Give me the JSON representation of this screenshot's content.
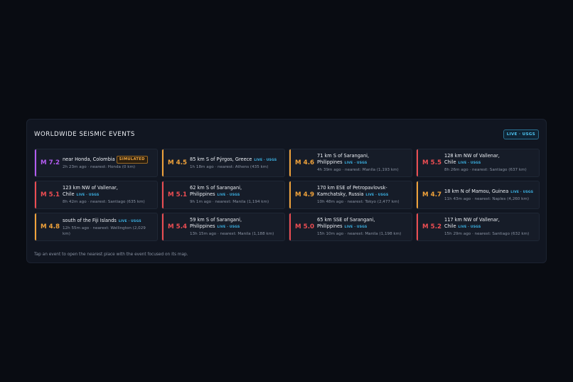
{
  "panel": {
    "title": "WORLDWIDE SEISMIC EVENTS",
    "badge": "LIVE · USGS",
    "footer": "Tap an event to open the nearest place with the event focused on its map."
  },
  "colors": {
    "purple": "#b25cf0",
    "orange": "#f0a23a",
    "red": "#ec4d52"
  },
  "events": [
    {
      "mag": "M 7.2",
      "color": "#b25cf0",
      "place": "near Honda, Colombia",
      "source": "",
      "badge": "SIMULATED",
      "meta": "2h 23m ago · nearest: Honda (0 km)"
    },
    {
      "mag": "M 4.5",
      "color": "#f0a23a",
      "place": "85 km S of Pýrgos, Greece",
      "source": "LIVE · USGS",
      "badge": "",
      "meta": "1h 18m ago · nearest: Athens (435 km)"
    },
    {
      "mag": "M 4.6",
      "color": "#f0a23a",
      "place": "71 km S of Sarangani, Philippines",
      "source": "LIVE · USGS",
      "badge": "",
      "meta": "4h 39m ago · nearest: Manila (1,193 km)"
    },
    {
      "mag": "M 5.5",
      "color": "#ec4d52",
      "place": "128 km NW of Vallenar, Chile",
      "source": "LIVE · USGS",
      "badge": "",
      "meta": "8h 26m ago · nearest: Santiago (637 km)"
    },
    {
      "mag": "M 5.1",
      "color": "#ec4d52",
      "place": "123 km NW of Vallenar, Chile",
      "source": "LIVE · USGS",
      "badge": "",
      "meta": "8h 42m ago · nearest: Santiago (635 km)"
    },
    {
      "mag": "M 5.1",
      "color": "#ec4d52",
      "place": "62 km S of Sarangani, Philippines",
      "source": "LIVE · USGS",
      "badge": "",
      "meta": "9h 1m ago · nearest: Manila (1,194 km)"
    },
    {
      "mag": "M 4.9",
      "color": "#f0a23a",
      "place": "170 km ESE of Petropavlovsk-Kamchatsky, Russia",
      "source": "LIVE · USGS",
      "badge": "",
      "meta": "10h 48m ago · nearest: Tokyo (2,477 km)"
    },
    {
      "mag": "M 4.7",
      "color": "#f0a23a",
      "place": "18 km N of Mamou, Guinea",
      "source": "LIVE · USGS",
      "badge": "",
      "meta": "11h 43m ago · nearest: Naples (4,260 km)"
    },
    {
      "mag": "M 4.8",
      "color": "#f0a23a",
      "place": "south of the Fiji Islands",
      "source": "LIVE · USGS",
      "badge": "",
      "meta": "12h 55m ago · nearest: Wellington (2,029 km)"
    },
    {
      "mag": "M 5.4",
      "color": "#ec4d52",
      "place": "59 km S of Sarangani, Philippines",
      "source": "LIVE · USGS",
      "badge": "",
      "meta": "13h 15m ago · nearest: Manila (1,188 km)"
    },
    {
      "mag": "M 5.0",
      "color": "#ec4d52",
      "place": "65 km SSE of Sarangani, Philippines",
      "source": "LIVE · USGS",
      "badge": "",
      "meta": "15h 10m ago · nearest: Manila (1,198 km)"
    },
    {
      "mag": "M 5.2",
      "color": "#ec4d52",
      "place": "117 km NW of Vallenar, Chile",
      "source": "LIVE · USGS",
      "badge": "",
      "meta": "15h 29m ago · nearest: Santiago (632 km)"
    }
  ]
}
